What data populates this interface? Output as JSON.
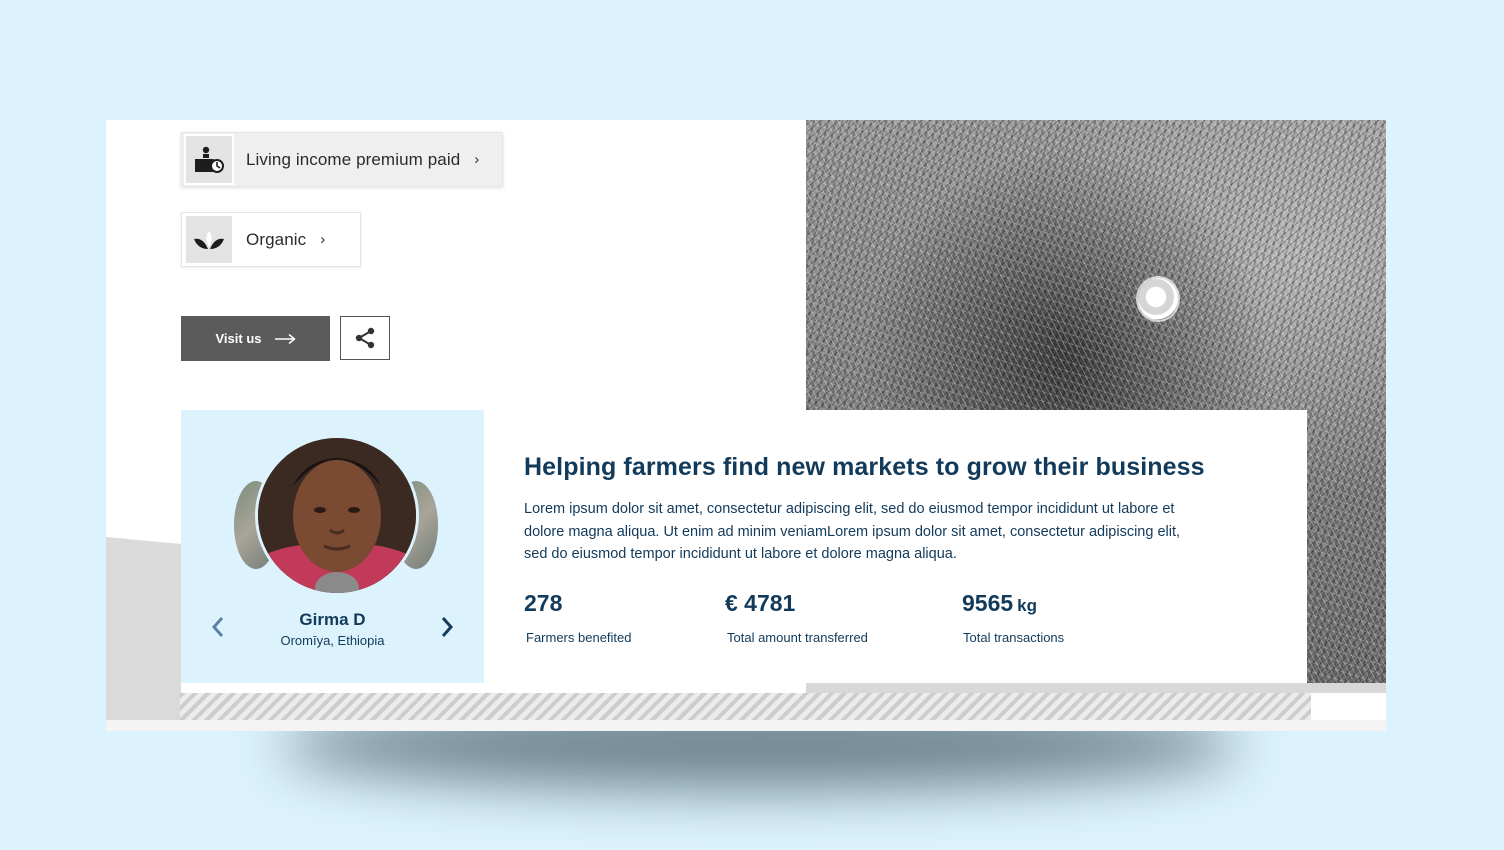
{
  "certifications": [
    {
      "label": "Living income premium paid",
      "icon": "hand-coin-icon"
    },
    {
      "label": "Organic",
      "icon": "leaf-icon"
    }
  ],
  "actions": {
    "visit_label": "Visit us",
    "visit_icon": "arrow-right-icon",
    "share_icon": "share-icon"
  },
  "profile": {
    "name": "Girma D",
    "location": "Oromīya, Ethiopia",
    "prev_icon": "chevron-left-icon",
    "next_icon": "chevron-right-icon"
  },
  "story": {
    "headline": "Helping farmers find new markets to grow their business",
    "body": "Lorem ipsum dolor sit amet, consectetur adipiscing elit, sed do eiusmod tempor incididunt ut labore et dolore magna aliqua. Ut enim ad minim veniamLorem ipsum dolor sit amet, consectetur adipiscing elit, sed do eiusmod tempor incididunt ut labore et dolore magna aliqua."
  },
  "stats": [
    {
      "value": "278",
      "unit": "",
      "label": "Farmers benefited"
    },
    {
      "value": "€ 4781",
      "unit": "",
      "label": "Total amount transferred"
    },
    {
      "value": "9565",
      "unit": "kg",
      "label": "Total transactions"
    }
  ],
  "colors": {
    "page_background": "#dcf3fd",
    "navy_text": "#123a5a",
    "button_grey": "#5b5b5b"
  }
}
